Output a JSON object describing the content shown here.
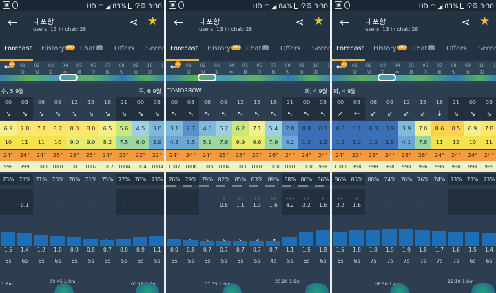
{
  "status": {
    "time": "오후 3:30",
    "battery_levels": [
      "83%",
      "84%",
      "83%"
    ]
  },
  "header": {
    "title": "내포항",
    "subtitle": "users: 13 in chat: 28"
  },
  "tabs": [
    "Forecast",
    "History",
    "Chat",
    "Offers",
    "Second"
  ],
  "tab_badges": {
    "history": "PRO",
    "chat": "13"
  },
  "strip": {
    "pro_label": "PRO",
    "day_numbers": [
      "01",
      "02",
      "03",
      "04",
      "05",
      "06",
      "07",
      "08",
      "09",
      "10",
      "11"
    ],
    "day_names": [
      "일",
      "월",
      "화",
      "수",
      "목",
      "금",
      "토",
      "일",
      "월",
      "화"
    ]
  },
  "hours": [
    "00",
    "03",
    "06",
    "09",
    "12",
    "15",
    "18",
    "21",
    "00",
    "03"
  ],
  "colors": {
    "speed_gradient": [
      "#3a6fb5",
      "#6aa6d6",
      "#9fd0e0",
      "#f3f08b",
      "#ffe66a",
      "#ffd04f",
      "#9ddc5b"
    ],
    "temp": "#f59a3d",
    "pressure": "#f1f2c4",
    "swell": "#1f6db3"
  },
  "panels": [
    {
      "battery": "83%",
      "header_left": "수, 5 9월",
      "header_right": "목, 6 9월",
      "wind_dirs": [
        "↘",
        "↘",
        "↘",
        "↘",
        "↘",
        "↘",
        "↘",
        "↘",
        "↘",
        "↘"
      ],
      "speed": [
        "6.9",
        "7.8",
        "7.7",
        "8.2",
        "8.0",
        "8.0",
        "6.5",
        "5.6",
        "4.5",
        "3.0"
      ],
      "gust": [
        "10",
        "11",
        "11",
        "10",
        "9.0",
        "9.0",
        "8.2",
        "7.5",
        "6.0",
        "3.9"
      ],
      "temp": [
        "24°",
        "24°",
        "24°",
        "25°",
        "25°",
        "25°",
        "24°",
        "23°",
        "22°",
        "22°"
      ],
      "pressure": [
        "999",
        "999",
        "1000",
        "1001",
        "1001",
        "1002",
        "1002",
        "1004",
        "1004",
        "1004"
      ],
      "cloud": [
        "73%",
        "73%",
        "71%",
        "70%",
        "70%",
        "71%",
        "75%",
        "77%",
        "76%",
        "73%"
      ],
      "rain": [
        "",
        "0.1",
        "",
        "",
        "",
        "",
        "",
        "",
        "",
        ""
      ],
      "rain_drops": [
        0,
        0,
        0,
        0,
        0,
        0,
        0,
        0,
        0,
        0
      ],
      "wave_dirs": [
        "↘",
        "↘",
        "↘",
        "↘",
        "↘",
        "↘",
        "↘",
        "↘",
        "↘",
        "→"
      ],
      "wave_height": [
        "1.5",
        "1.4",
        "1.2",
        "1.0",
        "0.9",
        "0.8",
        "0.7",
        "0.8",
        "0.9",
        "1.1"
      ],
      "wave_period": [
        "6s",
        "6s",
        "6s",
        "6s",
        "6s",
        "5s",
        "5s",
        "5s",
        "5s",
        "5s"
      ],
      "swell_levels": [
        0.62,
        0.58,
        0.48,
        0.42,
        0.38,
        0.32,
        0.28,
        0.32,
        0.38,
        0.46
      ],
      "tides": [
        "1.6m",
        "09:45 1.0m",
        "00:15 1.8m"
      ]
    },
    {
      "battery": "84%",
      "header_left": "TOMORROW",
      "header_right": "화, 4 9월",
      "wind_dirs": [
        "↖",
        "↖",
        "↖",
        "↖",
        "↖",
        "↖",
        "↖",
        "↖",
        "↖",
        "↖"
      ],
      "speed": [
        "3.1",
        "2.7",
        "4.0",
        "5.2",
        "6.2",
        "7.1",
        "5.4",
        "2.8",
        "0.8",
        "0.1"
      ],
      "gust": [
        "4.3",
        "3.5",
        "5.1",
        "7.6",
        "9.9",
        "9.6",
        "7.9",
        "4.2",
        "1.2",
        "1.2"
      ],
      "temp": [
        "24°",
        "24°",
        "24°",
        "25°",
        "25°",
        "27°",
        "26°",
        "24°",
        "24°",
        "24°"
      ],
      "pressure": [
        "1007",
        "1006",
        "1005",
        "1004",
        "1003",
        "1001",
        "1000",
        "1001",
        "1000",
        "998"
      ],
      "cloud": [
        "76%",
        "79%",
        "79%",
        "82%",
        "85%",
        "83%",
        "89%",
        "88%",
        "86%",
        "86%"
      ],
      "rain": [
        "",
        "",
        "",
        "0.6",
        "1.1",
        "1.3",
        "1.6",
        "4.2",
        "3.2",
        "1.6"
      ],
      "rain_drops": [
        0,
        0,
        0,
        1,
        2,
        2,
        2,
        3,
        2,
        1
      ],
      "wave_dirs": [
        "↘",
        "↘",
        "↘",
        "↘",
        "↘",
        "↗",
        "↗",
        "↗",
        "↗",
        "↗"
      ],
      "wave_height": [
        "0.9",
        "0.8",
        "0.7",
        "0.7",
        "0.7",
        "0.7",
        "0.7",
        "1.1",
        "1.5",
        "1.8"
      ],
      "wave_period": [
        "5s",
        "5s",
        "5s",
        "5s",
        "5s",
        "5s",
        "4s",
        "5s",
        "6s",
        "6s"
      ],
      "swell_levels": [
        0.32,
        0.28,
        0.24,
        0.22,
        0.22,
        0.22,
        0.22,
        0.38,
        0.62,
        0.72
      ],
      "tides": [
        "07:35 1.9m",
        "20:20 1.9m"
      ]
    },
    {
      "battery": "83%",
      "header_left": "화, 4 9월",
      "header_right": "",
      "wind_dirs": [
        "↗",
        "←",
        "↙",
        "↙",
        "↙",
        "↙",
        "↓",
        "↘",
        "↘",
        "↘"
      ],
      "speed": [
        "0.8",
        "0.1",
        "0.3",
        "0.9",
        "3.9",
        "7.0",
        "8.6",
        "8.5",
        "6.9",
        "7.8"
      ],
      "gust": [
        "1.2",
        "1.2",
        "1.2",
        "1.5",
        "4.1",
        "7.8",
        "11",
        "12",
        "10",
        "11"
      ],
      "temp": [
        "24°",
        "23°",
        "23°",
        "24°",
        "25°",
        "26°",
        "24°",
        "24°",
        "24°",
        "24°"
      ],
      "pressure": [
        "1000",
        "998",
        "998",
        "998",
        "998",
        "996",
        "996",
        "998",
        "998",
        "999"
      ],
      "cloud": [
        "86%",
        "85%",
        "80%",
        "74%",
        "76%",
        "76%",
        "74%",
        "73%",
        "73%",
        "73%"
      ],
      "rain": [
        "3.2",
        "1.6",
        "",
        "",
        "",
        "",
        "",
        "",
        "",
        ""
      ],
      "rain_drops": [
        2,
        1,
        0,
        0,
        0,
        0,
        0,
        0,
        0,
        0
      ],
      "wave_dirs": [
        "↘",
        "↘",
        "↘",
        "↘",
        "↘",
        "↘",
        "↘",
        "↘",
        "↘",
        "↘"
      ],
      "wave_height": [
        "1.5",
        "1.8",
        "1.8",
        "1.9",
        "1.9",
        "1.8",
        "1.7",
        "1.6",
        "1.5",
        "1.4"
      ],
      "wave_period": [
        "6s",
        "6s",
        "7s",
        "7s",
        "7s",
        "7s",
        "7s",
        "7s",
        "6s",
        "6s"
      ],
      "swell_levels": [
        0.62,
        0.72,
        0.72,
        0.76,
        0.76,
        0.72,
        0.68,
        0.65,
        0.62,
        0.58
      ],
      "tides": [
        "08:30 1.4m",
        "22:10 1.6m"
      ]
    }
  ]
}
